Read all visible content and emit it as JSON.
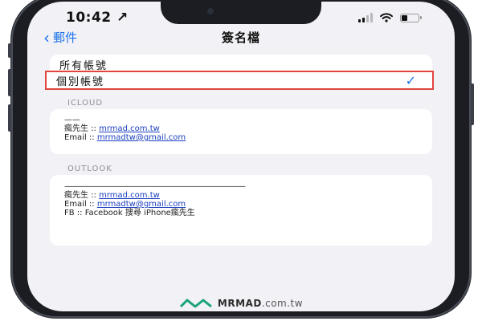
{
  "status_bar": {
    "time": "10:42 ↗"
  },
  "nav": {
    "back_label": "郵件",
    "title": "簽名檔"
  },
  "options": [
    {
      "label": "所有帳號",
      "selected": false
    },
    {
      "label": "個別帳號",
      "selected": true
    }
  ],
  "accounts": [
    {
      "section": "ICLOUD",
      "lines": [
        {
          "text": "——"
        },
        {
          "text": "瘋先生 :: ",
          "link": "mrmad.com.tw"
        },
        {
          "text": "Email :: ",
          "link": "mrmadtw@gmail.com"
        }
      ]
    },
    {
      "section": "OUTLOOK",
      "lines": [
        {
          "text": "—————————————————————————"
        },
        {
          "text": "瘋先生 :: ",
          "link": "mrmad.com.tw"
        },
        {
          "text": "Email :: ",
          "link": "mrmadtw@gmail.com"
        },
        {
          "text": "FB :: Facebook 搜尋 iPhone瘋先生"
        }
      ]
    }
  ],
  "watermark": {
    "brand": "MRMAD",
    "suffix": ".com.tw"
  },
  "colors": {
    "accent": "#1a73e8",
    "highlight": "#e0463c",
    "link": "#1a3fbf",
    "background": "#f2f2f6"
  }
}
